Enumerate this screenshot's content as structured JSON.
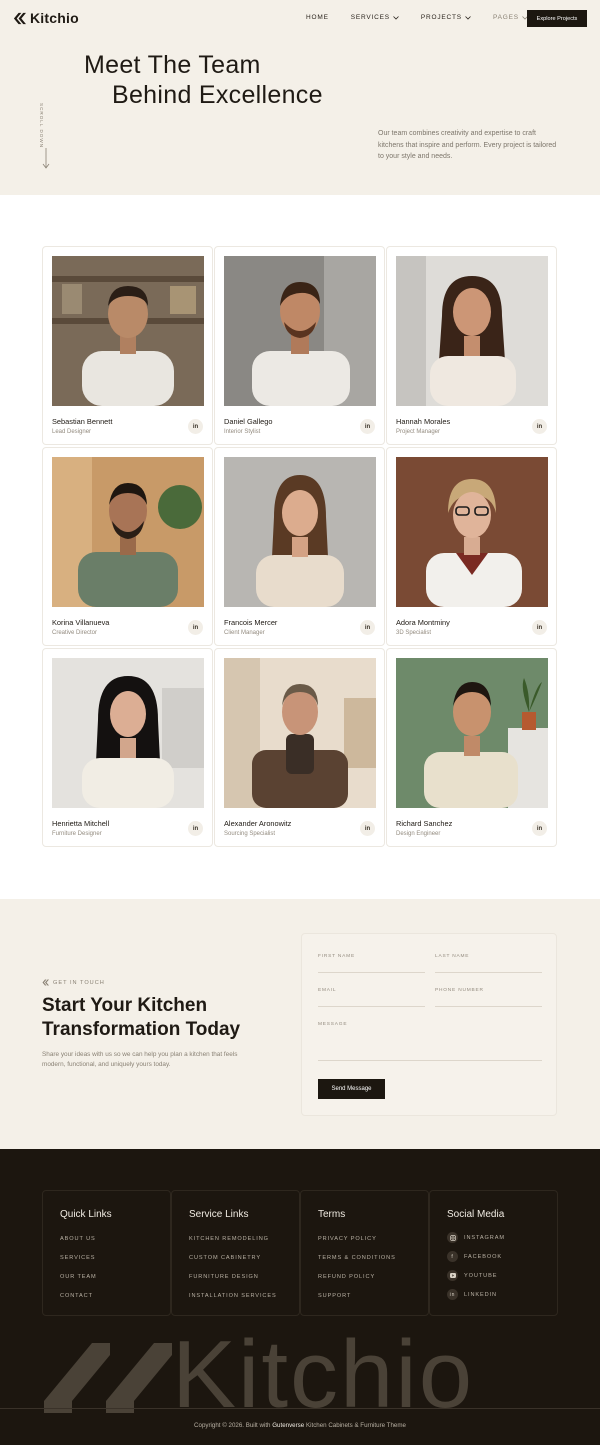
{
  "brand": {
    "name": "Kitchio"
  },
  "nav": {
    "items": [
      {
        "label": "HOME"
      },
      {
        "label": "SERVICES"
      },
      {
        "label": "PROJECTS"
      },
      {
        "label": "PAGES"
      }
    ],
    "cta": "Explore Projects"
  },
  "hero": {
    "title_line1": "Meet The Team",
    "title_line2": "Behind Excellence",
    "scroll_label": "SCROLL DOWN",
    "description": "Our team combines creativity and expertise to craft kitchens that inspire and perform. Every project is tailored to your style and needs."
  },
  "team": [
    {
      "name": "Sebastian Bennett",
      "role": "Lead Designer",
      "social": "in"
    },
    {
      "name": "Daniel Gallego",
      "role": "Interior Stylist",
      "social": "in"
    },
    {
      "name": "Hannah Morales",
      "role": "Project Manager",
      "social": "in"
    },
    {
      "name": "Korina Villanueva",
      "role": "Creative Director",
      "social": "in"
    },
    {
      "name": "Francois Mercer",
      "role": "Client Manager",
      "social": "in"
    },
    {
      "name": "Adora Montminy",
      "role": "3D Specialist",
      "social": "in"
    },
    {
      "name": "Henrietta Mitchell",
      "role": "Furniture Designer",
      "social": "in"
    },
    {
      "name": "Alexander Aronowitz",
      "role": "Sourcing Specialist",
      "social": "in"
    },
    {
      "name": "Richard Sanchez",
      "role": "Design Engineer",
      "social": "in"
    }
  ],
  "contact": {
    "eyebrow": "GET IN TOUCH",
    "title_line1": "Start Your Kitchen",
    "title_line2": "Transformation Today",
    "description": "Share your ideas with us so we can help you plan a kitchen that feels modern, functional, and uniquely yours today.",
    "fields": {
      "first_name": "FIRST NAME",
      "last_name": "LAST NAME",
      "email": "EMAIL",
      "phone": "PHONE NUMBER",
      "message": "MESSAGE"
    },
    "submit": "Send Message"
  },
  "footer": {
    "quick_links": {
      "title": "Quick Links",
      "items": [
        "ABOUT US",
        "SERVICES",
        "OUR TEAM",
        "CONTACT"
      ]
    },
    "service_links": {
      "title": "Service Links",
      "items": [
        "KITCHEN REMODELING",
        "CUSTOM CABINETRY",
        "FURNITURE DESIGN",
        "INSTALLATION SERVICES"
      ]
    },
    "terms": {
      "title": "Terms",
      "items": [
        "PRIVACY POLICY",
        "TERMS & CONDITIONS",
        "REFUND POLICY",
        "SUPPORT"
      ]
    },
    "social": {
      "title": "Social Media",
      "items": [
        {
          "label": "INSTAGRAM",
          "icon": "instagram-icon"
        },
        {
          "label": "FACEBOOK",
          "icon": "facebook-icon"
        },
        {
          "label": "YOUTUBE",
          "icon": "youtube-icon"
        },
        {
          "label": "LINKEDIN",
          "icon": "linkedin-icon"
        }
      ]
    },
    "big_wordmark": "Kitchio",
    "copyright_prefix": "Copyright © 2026. Built with",
    "copyright_brand": "Gutenverse",
    "copyright_suffix": "Kitchen Cabinets & Furniture Theme"
  },
  "colors": {
    "accent": "#1c1710",
    "cream": "#f4f0e8",
    "footer": "#1c160f"
  }
}
